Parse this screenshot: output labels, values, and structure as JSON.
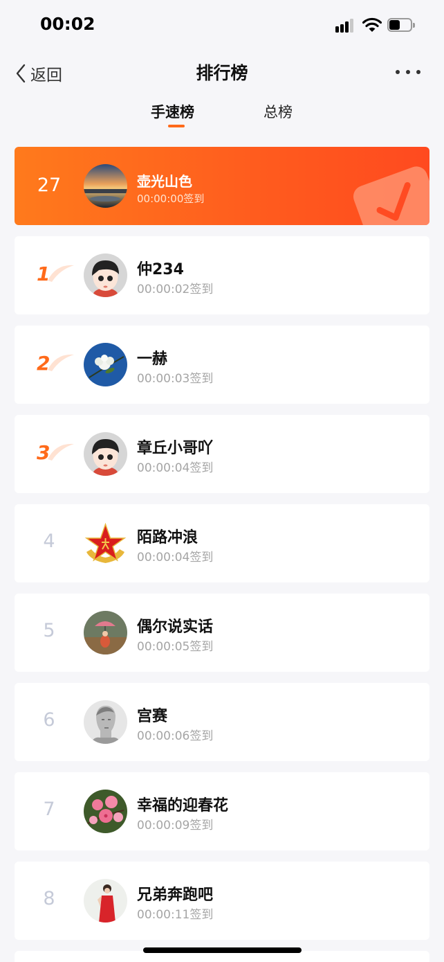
{
  "status_bar": {
    "time": "00:02"
  },
  "nav": {
    "back_label": "返回",
    "title": "排行榜"
  },
  "tabs": {
    "speed": "手速榜",
    "total": "总榜"
  },
  "me": {
    "rank": "27",
    "name": "壶光山色",
    "sign_time": "00:00:00签到"
  },
  "rankings": [
    {
      "rank": "1",
      "name": "仲234",
      "sign_time": "00:00:02签到",
      "avatar": "cartoon-avatar"
    },
    {
      "rank": "2",
      "name": "一赫",
      "sign_time": "00:00:03签到",
      "avatar": "flower-blue-avatar"
    },
    {
      "rank": "3",
      "name": "章丘小哥吖",
      "sign_time": "00:00:04签到",
      "avatar": "cartoon-avatar"
    },
    {
      "rank": "4",
      "name": "陌路冲浪",
      "sign_time": "00:00:04签到",
      "avatar": "red-star-avatar"
    },
    {
      "rank": "5",
      "name": "偶尔说实话",
      "sign_time": "00:00:05签到",
      "avatar": "umbrella-photo-avatar"
    },
    {
      "rank": "6",
      "name": "宫赛",
      "sign_time": "00:00:06签到",
      "avatar": "sketch-portrait-avatar"
    },
    {
      "rank": "7",
      "name": "幸福的迎春花",
      "sign_time": "00:00:09签到",
      "avatar": "pink-blossom-avatar"
    },
    {
      "rank": "8",
      "name": "兄弟奔跑吧",
      "sign_time": "00:00:11签到",
      "avatar": "red-dress-avatar"
    }
  ],
  "colors": {
    "accent": "#ff6a1a",
    "background": "#f6f6f9",
    "muted": "#a5a5a5"
  }
}
